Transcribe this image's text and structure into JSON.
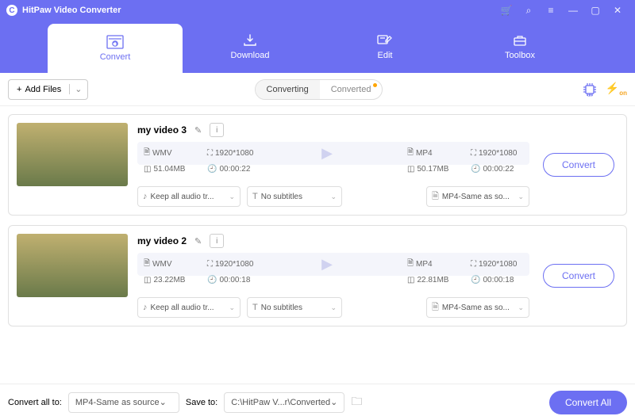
{
  "app": {
    "title": "HitPaw Video Converter"
  },
  "nav": {
    "convert": "Convert",
    "download": "Download",
    "edit": "Edit",
    "toolbox": "Toolbox"
  },
  "toolbar": {
    "add_files": "Add Files",
    "converting": "Converting",
    "converted": "Converted"
  },
  "items": [
    {
      "name": "my video 3",
      "src": {
        "fmt": "WMV",
        "res": "1920*1080",
        "size": "51.04MB",
        "dur": "00:00:22"
      },
      "dst": {
        "fmt": "MP4",
        "res": "1920*1080",
        "size": "50.17MB",
        "dur": "00:00:22"
      },
      "audio": "Keep all audio tr...",
      "subtitle": "No subtitles",
      "fmt_sel": "MP4-Same as so...",
      "btn": "Convert"
    },
    {
      "name": "my video 2",
      "src": {
        "fmt": "WMV",
        "res": "1920*1080",
        "size": "23.22MB",
        "dur": "00:00:18"
      },
      "dst": {
        "fmt": "MP4",
        "res": "1920*1080",
        "size": "22.81MB",
        "dur": "00:00:18"
      },
      "audio": "Keep all audio tr...",
      "subtitle": "No subtitles",
      "fmt_sel": "MP4-Same as so...",
      "btn": "Convert"
    }
  ],
  "footer": {
    "convert_all_label": "Convert all to:",
    "convert_all_value": "MP4-Same as source",
    "save_to_label": "Save to:",
    "save_to_value": "C:\\HitPaw V...r\\Converted",
    "convert_all_btn": "Convert All"
  }
}
